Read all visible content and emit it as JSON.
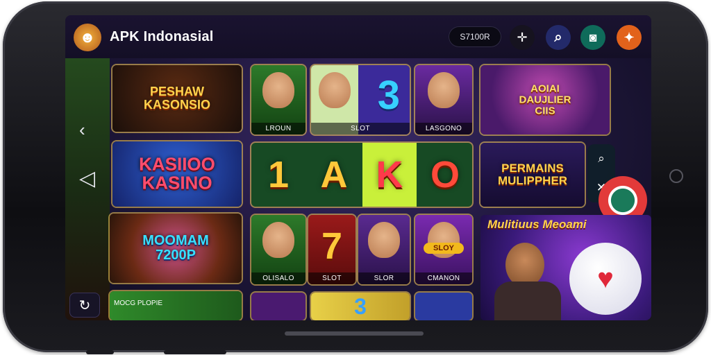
{
  "header": {
    "title": "APK Indonasial",
    "balance": "S7100R",
    "logo_icon": "mascot-logo-icon",
    "buttons": [
      {
        "icon": "crosshair-icon",
        "glyph": "✛",
        "color": "#16131f"
      },
      {
        "icon": "search-icon",
        "glyph": "⌕",
        "color": "#232a6a"
      },
      {
        "icon": "camera-icon",
        "glyph": "◙",
        "color": "#0f6b5a"
      },
      {
        "icon": "flame-icon",
        "glyph": "✦",
        "color": "#e2621b"
      }
    ]
  },
  "tiles": {
    "peshaw": {
      "title": "PESHAW\nKASONSIO"
    },
    "kasiioo": {
      "title": "KASIIOO\nKASINO"
    },
    "moomam": {
      "title": "MOOMAM\n7200P"
    },
    "mocg": {
      "caption": "MOCG PLOPIE"
    },
    "lroun": {
      "caption": "LROUN"
    },
    "slot3": {
      "caption": "SLOT",
      "symbol": "3"
    },
    "lasgono": {
      "caption": "LASGONO"
    },
    "reels": [
      "1",
      "A",
      "K",
      "O"
    ],
    "aidal": {
      "title": "AOIAI\nDAUJLIER\nCIIS"
    },
    "permains": {
      "title": "PERMAINS\nMULIPPHER"
    },
    "olisalo": {
      "caption": "OLISALO"
    },
    "slot7": {
      "caption": "SLOT",
      "symbol": "7"
    },
    "slor": {
      "caption": "SLOR"
    },
    "cmanon": {
      "caption": "CMANON",
      "badge": "SLOY"
    },
    "multiplayer": {
      "title": "Mulitiuus Meoami"
    }
  },
  "bottom_row": {
    "symbol": "3"
  },
  "colors": {
    "accent": "#ffd34d",
    "panel": "#1d1638",
    "brand_orange": "#e2621b"
  }
}
